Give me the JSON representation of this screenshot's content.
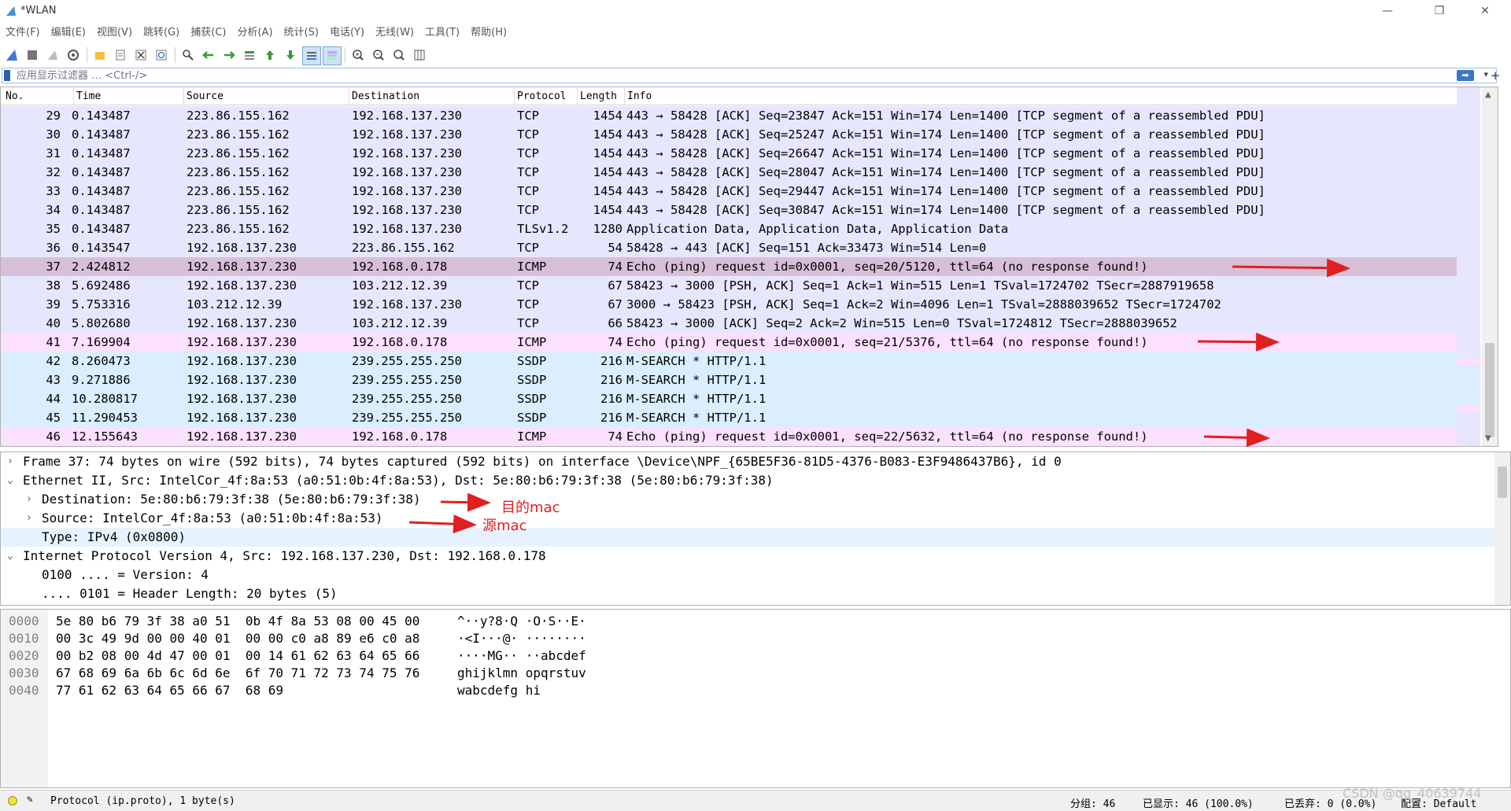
{
  "window": {
    "title": "*WLAN"
  },
  "menu": [
    "文件(F)",
    "编辑(E)",
    "视图(V)",
    "跳转(G)",
    "捕获(C)",
    "分析(A)",
    "统计(S)",
    "电话(Y)",
    "无线(W)",
    "工具(T)",
    "帮助(H)"
  ],
  "filter": {
    "placeholder": "应用显示过滤器 … <Ctrl-/>"
  },
  "packet_list": {
    "columns": [
      "No.",
      "Time",
      "Source",
      "Destination",
      "Protocol",
      "Length",
      "Info"
    ],
    "rows": [
      {
        "no": "29",
        "time": "0.143487",
        "src": "223.86.155.162",
        "dst": "192.168.137.230",
        "proto": "TCP",
        "len": "1454",
        "info": "443 → 58428 [ACK] Seq=23847 Ack=151 Win=174 Len=1400 [TCP segment of a reassembled PDU]",
        "kind": "tcp"
      },
      {
        "no": "30",
        "time": "0.143487",
        "src": "223.86.155.162",
        "dst": "192.168.137.230",
        "proto": "TCP",
        "len": "1454",
        "info": "443 → 58428 [ACK] Seq=25247 Ack=151 Win=174 Len=1400 [TCP segment of a reassembled PDU]",
        "kind": "tcp"
      },
      {
        "no": "31",
        "time": "0.143487",
        "src": "223.86.155.162",
        "dst": "192.168.137.230",
        "proto": "TCP",
        "len": "1454",
        "info": "443 → 58428 [ACK] Seq=26647 Ack=151 Win=174 Len=1400 [TCP segment of a reassembled PDU]",
        "kind": "tcp"
      },
      {
        "no": "32",
        "time": "0.143487",
        "src": "223.86.155.162",
        "dst": "192.168.137.230",
        "proto": "TCP",
        "len": "1454",
        "info": "443 → 58428 [ACK] Seq=28047 Ack=151 Win=174 Len=1400 [TCP segment of a reassembled PDU]",
        "kind": "tcp"
      },
      {
        "no": "33",
        "time": "0.143487",
        "src": "223.86.155.162",
        "dst": "192.168.137.230",
        "proto": "TCP",
        "len": "1454",
        "info": "443 → 58428 [ACK] Seq=29447 Ack=151 Win=174 Len=1400 [TCP segment of a reassembled PDU]",
        "kind": "tcp"
      },
      {
        "no": "34",
        "time": "0.143487",
        "src": "223.86.155.162",
        "dst": "192.168.137.230",
        "proto": "TCP",
        "len": "1454",
        "info": "443 → 58428 [ACK] Seq=30847 Ack=151 Win=174 Len=1400 [TCP segment of a reassembled PDU]",
        "kind": "tcp"
      },
      {
        "no": "35",
        "time": "0.143487",
        "src": "223.86.155.162",
        "dst": "192.168.137.230",
        "proto": "TLSv1.2",
        "len": "1280",
        "info": "Application Data, Application Data, Application Data",
        "kind": "tcp"
      },
      {
        "no": "36",
        "time": "0.143547",
        "src": "192.168.137.230",
        "dst": "223.86.155.162",
        "proto": "TCP",
        "len": "54",
        "info": "58428 → 443 [ACK] Seq=151 Ack=33473 Win=514 Len=0",
        "kind": "tcp"
      },
      {
        "no": "37",
        "time": "2.424812",
        "src": "192.168.137.230",
        "dst": "192.168.0.178",
        "proto": "ICMP",
        "len": "74",
        "info": "Echo (ping) request  id=0x0001, seq=20/5120, ttl=64 (no response found!)",
        "kind": "sel"
      },
      {
        "no": "38",
        "time": "5.692486",
        "src": "192.168.137.230",
        "dst": "103.212.12.39",
        "proto": "TCP",
        "len": "67",
        "info": "58423 → 3000 [PSH, ACK] Seq=1 Ack=1 Win=515 Len=1 TSval=1724702 TSecr=2887919658",
        "kind": "tcp"
      },
      {
        "no": "39",
        "time": "5.753316",
        "src": "103.212.12.39",
        "dst": "192.168.137.230",
        "proto": "TCP",
        "len": "67",
        "info": "3000 → 58423 [PSH, ACK] Seq=1 Ack=2 Win=4096 Len=1 TSval=2888039652 TSecr=1724702",
        "kind": "tcp"
      },
      {
        "no": "40",
        "time": "5.802680",
        "src": "192.168.137.230",
        "dst": "103.212.12.39",
        "proto": "TCP",
        "len": "66",
        "info": "58423 → 3000 [ACK] Seq=2 Ack=2 Win=515 Len=0 TSval=1724812 TSecr=2888039652",
        "kind": "tcp"
      },
      {
        "no": "41",
        "time": "7.169904",
        "src": "192.168.137.230",
        "dst": "192.168.0.178",
        "proto": "ICMP",
        "len": "74",
        "info": "Echo (ping) request  id=0x0001, seq=21/5376, ttl=64 (no response found!)",
        "kind": "icmp"
      },
      {
        "no": "42",
        "time": "8.260473",
        "src": "192.168.137.230",
        "dst": "239.255.255.250",
        "proto": "SSDP",
        "len": "216",
        "info": "M-SEARCH * HTTP/1.1",
        "kind": "ssdp"
      },
      {
        "no": "43",
        "time": "9.271886",
        "src": "192.168.137.230",
        "dst": "239.255.255.250",
        "proto": "SSDP",
        "len": "216",
        "info": "M-SEARCH * HTTP/1.1",
        "kind": "ssdp"
      },
      {
        "no": "44",
        "time": "10.280817",
        "src": "192.168.137.230",
        "dst": "239.255.255.250",
        "proto": "SSDP",
        "len": "216",
        "info": "M-SEARCH * HTTP/1.1",
        "kind": "ssdp"
      },
      {
        "no": "45",
        "time": "11.290453",
        "src": "192.168.137.230",
        "dst": "239.255.255.250",
        "proto": "SSDP",
        "len": "216",
        "info": "M-SEARCH * HTTP/1.1",
        "kind": "ssdp"
      },
      {
        "no": "46",
        "time": "12.155643",
        "src": "192.168.137.230",
        "dst": "192.168.0.178",
        "proto": "ICMP",
        "len": "74",
        "info": "Echo (ping) request  id=0x0001, seq=22/5632, ttl=64 (no response found!)",
        "kind": "icmp"
      }
    ]
  },
  "details": {
    "rows": [
      {
        "arrow": ">",
        "level": 0,
        "text": "Frame 37: 74 bytes on wire (592 bits), 74 bytes captured (592 bits) on interface \\Device\\NPF_{65BE5F36-81D5-4376-B083-E3F9486437B6}, id 0"
      },
      {
        "arrow": "v",
        "level": 0,
        "text": "Ethernet II, Src: IntelCor_4f:8a:53 (a0:51:0b:4f:8a:53), Dst: 5e:80:b6:79:3f:38 (5e:80:b6:79:3f:38)"
      },
      {
        "arrow": ">",
        "level": 1,
        "text": "Destination: 5e:80:b6:79:3f:38 (5e:80:b6:79:3f:38)"
      },
      {
        "arrow": ">",
        "level": 1,
        "text": "Source: IntelCor_4f:8a:53 (a0:51:0b:4f:8a:53)"
      },
      {
        "arrow": "",
        "level": 1,
        "text": "Type: IPv4 (0x0800)"
      },
      {
        "arrow": "v",
        "level": 0,
        "text": "Internet Protocol Version 4, Src: 192.168.137.230, Dst: 192.168.0.178"
      },
      {
        "arrow": "",
        "level": 1,
        "text": "0100 .... = Version: 4"
      },
      {
        "arrow": "",
        "level": 1,
        "text": ".... 0101 = Header Length: 20 bytes (5)"
      }
    ],
    "annotations": {
      "dst_mac": "目的mac",
      "src_mac": "源mac"
    }
  },
  "bytes": {
    "rows": [
      {
        "off": "0000",
        "hex": "5e 80 b6 79 3f 38 a0 51  0b 4f 8a 53 08 00 45 00",
        "ascii": "^··y?8·Q ·O·S··E·"
      },
      {
        "off": "0010",
        "hex": "00 3c 49 9d 00 00 40 01  00 00 c0 a8 89 e6 c0 a8",
        "ascii": "·<I···@· ········"
      },
      {
        "off": "0020",
        "hex": "00 b2 08 00 4d 47 00 01  00 14 61 62 63 64 65 66",
        "ascii": "····MG·· ··abcdef"
      },
      {
        "off": "0030",
        "hex": "67 68 69 6a 6b 6c 6d 6e  6f 70 71 72 73 74 75 76",
        "ascii": "ghijklmn opqrstuv"
      },
      {
        "off": "0040",
        "hex": "77 61 62 63 64 65 66 67  68 69",
        "ascii": "wabcdefg hi"
      }
    ]
  },
  "status": {
    "field": "Protocol (ip.proto), 1 byte(s)",
    "packets": "分组: 46",
    "displayed": "已显示: 46 (100.0%)",
    "dropped": "已丢弃: 0 (0.0%)",
    "profile": "配置: Default"
  },
  "watermark": "CSDN @qq_40639744",
  "colors": {
    "tcp": "#e7e6ff",
    "icmp": "#fce0ff",
    "ssdp": "#daeeff",
    "selected": "#d8bfd8",
    "annotation": "#e02020"
  }
}
